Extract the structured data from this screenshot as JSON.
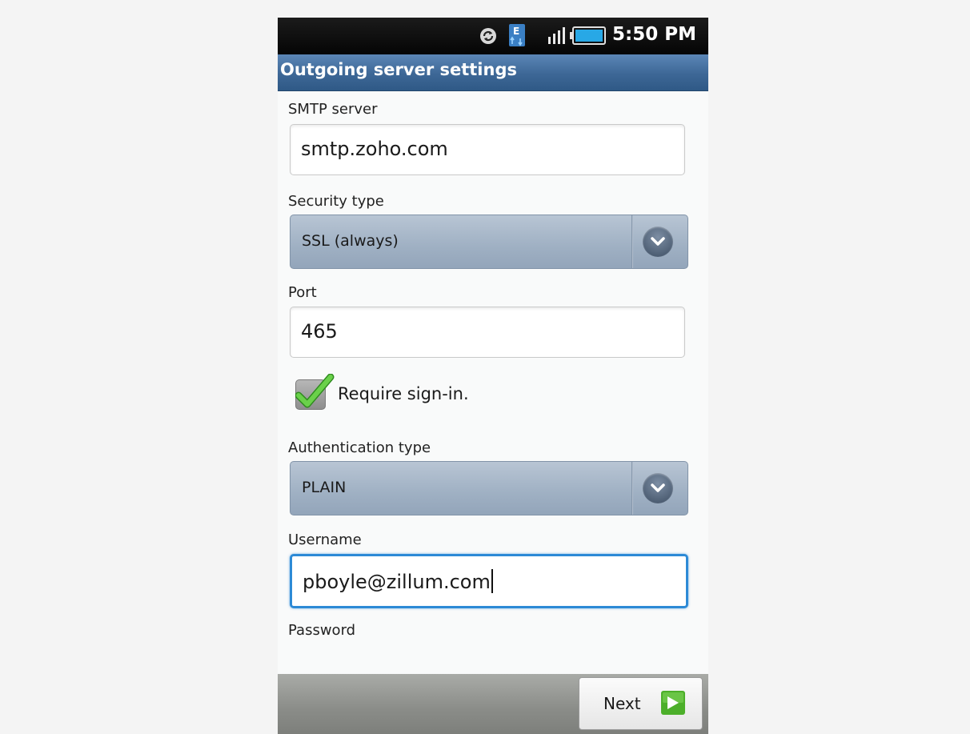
{
  "status_bar": {
    "time": "5:50 PM",
    "icons": [
      "sync-icon",
      "edge-data-icon",
      "signal-icon",
      "battery-icon"
    ]
  },
  "title_bar": {
    "title": "Outgoing server settings"
  },
  "form": {
    "smtp_server": {
      "label": "SMTP server",
      "value": "smtp.zoho.com"
    },
    "security_type": {
      "label": "Security type",
      "selected": "SSL (always)"
    },
    "port": {
      "label": "Port",
      "value": "465"
    },
    "require_signin": {
      "label": "Require sign-in.",
      "checked": true
    },
    "authentication_type": {
      "label": "Authentication type",
      "selected": "PLAIN"
    },
    "username": {
      "label": "Username",
      "value": "pboyle@zillum.com"
    },
    "password": {
      "label": "Password"
    }
  },
  "bottom_bar": {
    "next_label": "Next"
  },
  "colors": {
    "title_bar": "#3d6796",
    "focus_border": "#2d8ad6",
    "checkmark": "#57c43a",
    "next_arrow": "#4caf2a"
  }
}
